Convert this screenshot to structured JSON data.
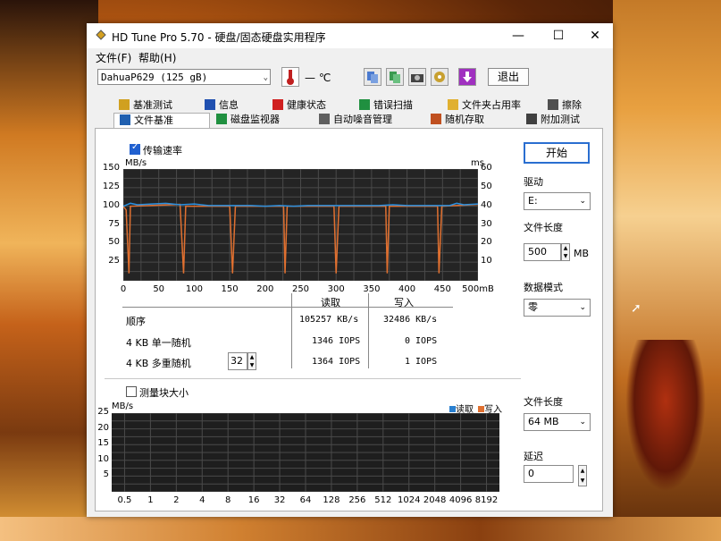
{
  "window": {
    "title": "HD Tune Pro 5.70 - 硬盘/固态硬盘实用程序"
  },
  "menu": {
    "file": "文件(F)",
    "help": "帮助(H)"
  },
  "toolbar": {
    "drive": "DahuaP629 (125 gB)",
    "temp": "— ℃",
    "exit": "退出"
  },
  "tabs_top": [
    "基准测试",
    "信息",
    "健康状态",
    "错误扫描",
    "文件夹占用率",
    "擦除"
  ],
  "tabs_bottom": [
    "文件基准",
    "磁盘监视器",
    "自动噪音管理",
    "随机存取",
    "附加测试"
  ],
  "transfer": {
    "checkbox_label": "传输速率",
    "unit_left": "MB/s",
    "unit_right": "ms",
    "y_left": [
      "150",
      "125",
      "100",
      "75",
      "50",
      "25"
    ],
    "y_right": [
      "60",
      "50",
      "40",
      "30",
      "20",
      "10"
    ],
    "x_ticks": [
      "0",
      "50",
      "100",
      "150",
      "200",
      "250",
      "300",
      "350",
      "400",
      "450",
      "500mB"
    ]
  },
  "results": {
    "col_read": "读取",
    "col_write": "写入",
    "rows": [
      {
        "label": "顺序",
        "read": "105257 KB/s",
        "write": "32486 KB/s"
      },
      {
        "label": "4 KB 单一随机",
        "read": "1346 IOPS",
        "write": "0 IOPS"
      },
      {
        "label": "4 KB 多重随机",
        "read": "1364 IOPS",
        "write": "1 IOPS"
      }
    ],
    "queue_depth": "32"
  },
  "block": {
    "checkbox_label": "测量块大小",
    "unit": "MB/s",
    "legend_read": "读取",
    "legend_write": "写入",
    "y": [
      "25",
      "20",
      "15",
      "10",
      "5"
    ],
    "x": [
      "0.5",
      "1",
      "2",
      "4",
      "8",
      "16",
      "32",
      "64",
      "128",
      "256",
      "512",
      "1024",
      "2048",
      "4096",
      "8192"
    ]
  },
  "side": {
    "start": "开始",
    "drive_label": "驱动",
    "drive_value": "E:",
    "filelen_label": "文件长度",
    "filelen_value": "500",
    "filelen_unit": "MB",
    "pattern_label": "数据模式",
    "pattern_value": "零",
    "filelen2_label": "文件长度",
    "filelen2_value": "64 MB",
    "delay_label": "延迟",
    "delay_value": "0"
  },
  "chart_data": {
    "type": "line",
    "xlabel": "",
    "ylabel": "MB/s",
    "xlim": [
      0,
      500
    ],
    "ylim": [
      0,
      150
    ],
    "y2lim": [
      0,
      60
    ],
    "series": [
      {
        "values": [
          [
            0,
            100
          ],
          [
            10,
            104
          ],
          [
            20,
            102
          ],
          [
            40,
            103
          ],
          [
            60,
            104
          ],
          [
            80,
            102
          ],
          [
            100,
            103
          ],
          [
            120,
            101
          ],
          [
            140,
            101
          ],
          [
            160,
            101
          ],
          [
            180,
            101
          ],
          [
            200,
            100
          ],
          [
            220,
            101
          ],
          [
            240,
            100
          ],
          [
            260,
            101
          ],
          [
            280,
            101
          ],
          [
            300,
            101
          ],
          [
            320,
            101
          ],
          [
            340,
            101
          ],
          [
            360,
            101
          ],
          [
            380,
            102
          ],
          [
            400,
            101
          ],
          [
            420,
            101
          ],
          [
            440,
            101
          ],
          [
            460,
            101
          ],
          [
            470,
            104
          ],
          [
            480,
            102
          ],
          [
            500,
            103
          ]
        ]
      },
      {
        "values": [
          [
            0,
            40
          ],
          [
            4,
            38
          ],
          [
            8,
            4
          ],
          [
            10,
            40
          ],
          [
            80,
            41
          ],
          [
            85,
            4
          ],
          [
            88,
            40
          ],
          [
            150,
            40
          ],
          [
            154,
            4
          ],
          [
            158,
            40
          ],
          [
            226,
            40
          ],
          [
            228,
            4
          ],
          [
            231,
            40
          ],
          [
            297,
            40
          ],
          [
            300,
            4
          ],
          [
            304,
            40
          ],
          [
            370,
            40
          ],
          [
            372,
            4
          ],
          [
            375,
            40
          ],
          [
            443,
            40
          ],
          [
            445,
            4
          ],
          [
            449,
            40
          ],
          [
            500,
            41
          ]
        ]
      }
    ],
    "grid": true
  }
}
